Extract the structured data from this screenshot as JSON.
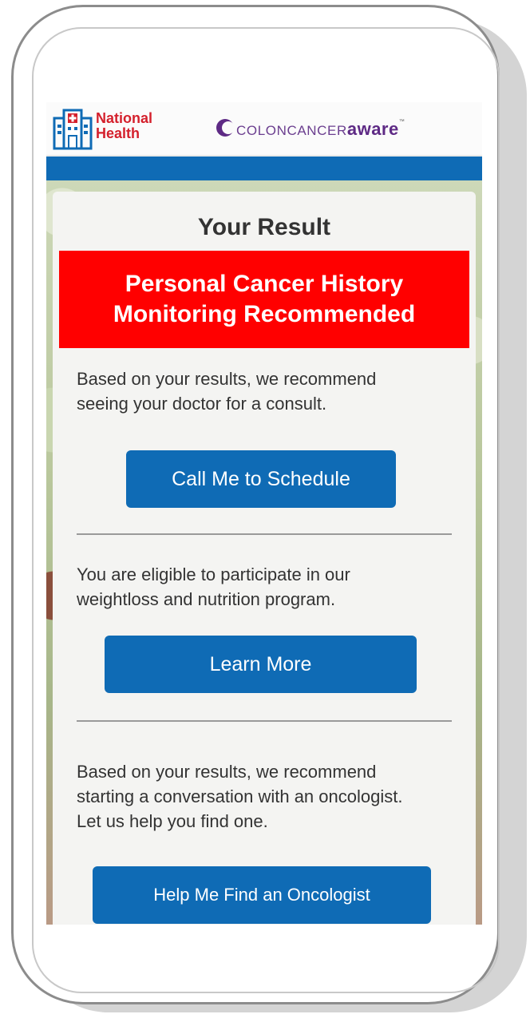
{
  "header": {
    "national_health_line1": "National",
    "national_health_line2": "Health",
    "colon_part1": "COLONCANCER",
    "colon_part2": "aware",
    "colon_tm": "™"
  },
  "result": {
    "title": "Your Result",
    "banner_line1": "Personal Cancer History",
    "banner_line2": "Monitoring Recommended"
  },
  "sections": [
    {
      "text_line1": "Based on your results, we recommend",
      "text_line2": "seeing your doctor for a consult.",
      "button": "Call Me to Schedule"
    },
    {
      "text_line1": "You are eligible to participate in our",
      "text_line2": "weightloss and nutrition program.",
      "button": "Learn More"
    },
    {
      "text_line1": "Based on your results, we recommend",
      "text_line2": "starting a conversation with an oncologist.",
      "text_line3": "Let us help you find one.",
      "button": "Help Me Find an Oncologist"
    }
  ],
  "colors": {
    "brand_blue": "#0f6bb5",
    "alert_red": "#ff0000",
    "national_health_red": "#d4202c",
    "colon_purple": "#5e2a85"
  },
  "icons": [
    "hospital-icon",
    "colon-cancer-aware-ribbon-icon"
  ]
}
